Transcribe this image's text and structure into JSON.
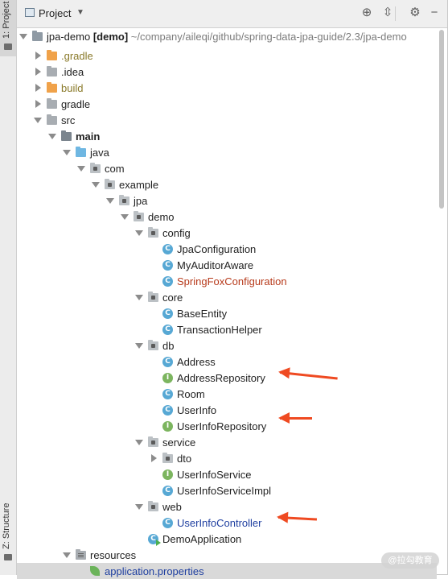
{
  "colors": {
    "accent_arrow": "#ef4a21",
    "class_icon": "#57a8d4",
    "interface_icon": "#7cb55f",
    "excluded_folder": "#f0a24a"
  },
  "strip": {
    "project_tab": "1: Project",
    "structure_tab": "Z: Structure"
  },
  "header": {
    "title": "Project",
    "locate_icon": "crosshair-icon",
    "collapse_icon": "collapse-all-icon",
    "settings_icon": "gear-icon",
    "hide_icon": "minimize-icon"
  },
  "tree": [
    {
      "label": "jpa-demo",
      "suffix": " [demo]",
      "path": " ~/company/aileqi/github/spring-data-jpa-guide/2.3/jpa-demo",
      "icon": "module-folder-icon",
      "bold_label": false
    },
    {
      "label": ".gradle",
      "icon": "excluded-folder-icon"
    },
    {
      "label": ".idea",
      "icon": "folder-icon"
    },
    {
      "label": "build",
      "icon": "excluded-folder-icon"
    },
    {
      "label": "gradle",
      "icon": "folder-icon"
    },
    {
      "label": "src",
      "icon": "folder-icon"
    },
    {
      "label": "main",
      "icon": "source-root-folder-icon"
    },
    {
      "label": "java",
      "icon": "java-source-folder-icon"
    },
    {
      "label": "com",
      "icon": "package-icon"
    },
    {
      "label": "example",
      "icon": "package-icon"
    },
    {
      "label": "jpa",
      "icon": "package-icon"
    },
    {
      "label": "demo",
      "icon": "package-icon"
    },
    {
      "label": "config",
      "icon": "package-icon"
    },
    {
      "label": "JpaConfiguration",
      "icon": "class-icon"
    },
    {
      "label": "MyAuditorAware",
      "icon": "class-icon"
    },
    {
      "label": "SpringFoxConfiguration",
      "icon": "class-icon"
    },
    {
      "label": "core",
      "icon": "package-icon"
    },
    {
      "label": "BaseEntity",
      "icon": "class-icon"
    },
    {
      "label": "TransactionHelper",
      "icon": "class-icon"
    },
    {
      "label": "db",
      "icon": "package-icon"
    },
    {
      "label": "Address",
      "icon": "class-icon"
    },
    {
      "label": "AddressRepository",
      "icon": "interface-icon"
    },
    {
      "label": "Room",
      "icon": "class-icon"
    },
    {
      "label": "UserInfo",
      "icon": "class-icon"
    },
    {
      "label": "UserInfoRepository",
      "icon": "interface-icon"
    },
    {
      "label": "service",
      "icon": "package-icon"
    },
    {
      "label": "dto",
      "icon": "package-icon"
    },
    {
      "label": "UserInfoService",
      "icon": "interface-icon"
    },
    {
      "label": "UserInfoServiceImpl",
      "icon": "class-icon"
    },
    {
      "label": "web",
      "icon": "package-icon"
    },
    {
      "label": "UserInfoController",
      "icon": "class-icon"
    },
    {
      "label": "DemoApplication",
      "icon": "spring-boot-app-icon"
    },
    {
      "label": "resources",
      "icon": "resources-folder-icon"
    },
    {
      "label": "application.properties",
      "icon": "spring-properties-icon"
    }
  ],
  "class_letter": "C",
  "interface_letter": "I",
  "watermark": "@拉勾教育"
}
